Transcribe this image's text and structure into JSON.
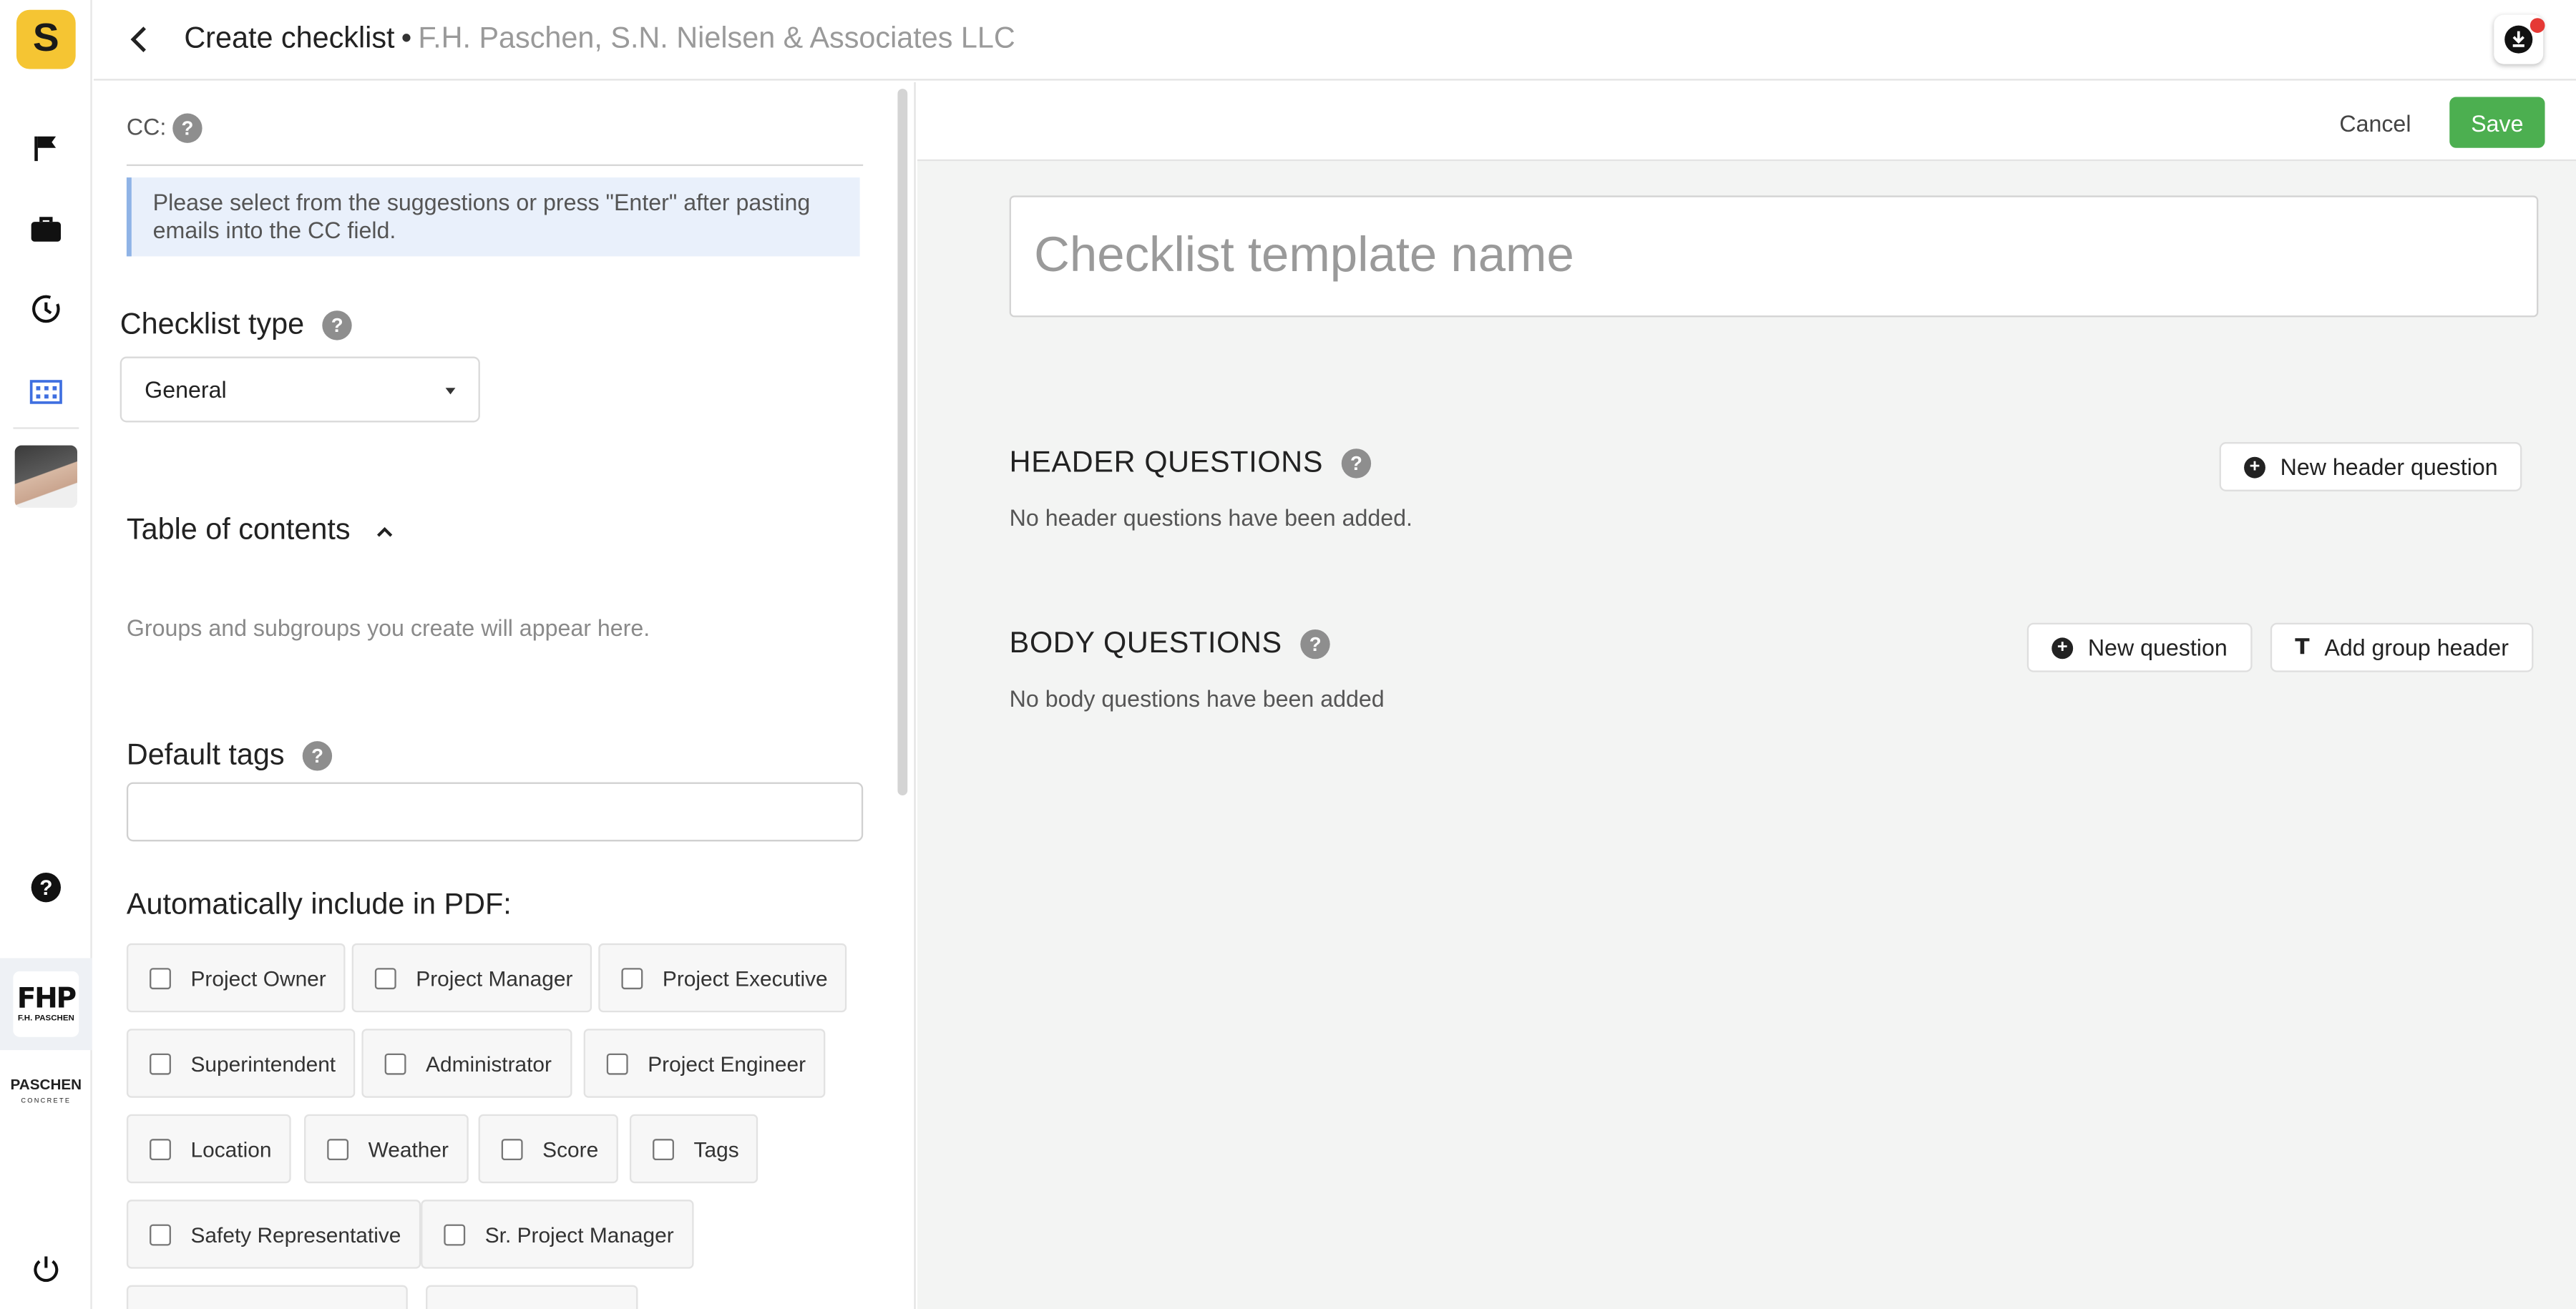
{
  "app": {
    "logo_letter": "S"
  },
  "topbar": {
    "title": "Create checklist",
    "separator": "•",
    "org": "F.H. Paschen, S.N. Nielsen & Associates LLC"
  },
  "rail": {
    "companies": [
      {
        "name": "F.H. PASCHEN",
        "mark": "FHP"
      },
      {
        "name": "PASCHEN",
        "sub": "CONCRETE"
      }
    ]
  },
  "form": {
    "cc_label": "CC:",
    "cc_info": "Please select from the suggestions or press \"Enter\" after pasting emails into the CC field.",
    "checklist_type_label": "Checklist type",
    "checklist_type_value": "General",
    "toc_label": "Table of contents",
    "toc_hint": "Groups and subgroups you create will appear here.",
    "default_tags_label": "Default tags",
    "pdf_label": "Automatically include in PDF:",
    "pdf_options": [
      "Project Owner",
      "Project Manager",
      "Project Executive",
      "Superintendent",
      "Administrator",
      "Project Engineer",
      "Location",
      "Weather",
      "Score",
      "Tags",
      "Safety Representative",
      "Sr. Project Manager"
    ]
  },
  "builder": {
    "cancel_label": "Cancel",
    "save_label": "Save",
    "name_placeholder": "Checklist template name",
    "header_title": "HEADER QUESTIONS",
    "header_empty": "No header questions have been added.",
    "new_header_label": "New header question",
    "body_title": "BODY QUESTIONS",
    "body_empty": "No body questions have been added",
    "new_question_label": "New question",
    "add_group_label": "Add group header"
  },
  "colors": {
    "brand_yellow": "#f5c533",
    "save_green": "#4caf50",
    "info_bg": "#e9f0fb",
    "notification_red": "#e53935"
  }
}
